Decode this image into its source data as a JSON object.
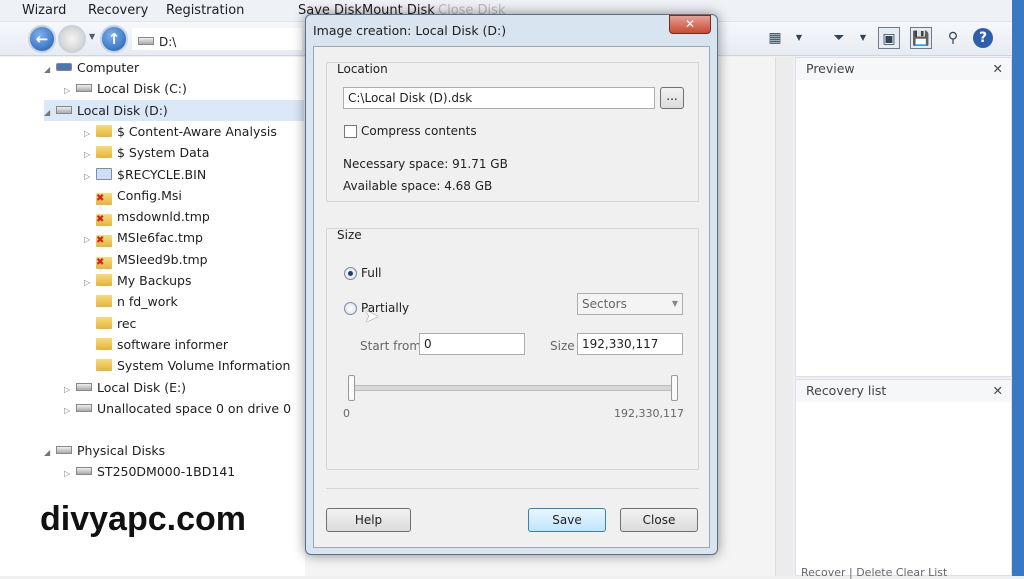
{
  "menu": {
    "items": [
      "Wizard",
      "Recovery",
      "Registration"
    ],
    "disk_actions": [
      "Save Disk",
      "Mount Disk",
      "Close Disk"
    ]
  },
  "nav": {
    "address": "D:\\"
  },
  "toolbar": {
    "icons": [
      "view-mode-icon",
      "filter-icon",
      "preview-toggle-icon",
      "save-icon",
      "search-icon",
      "help-icon"
    ]
  },
  "tree": {
    "items": [
      {
        "label": "Computer",
        "level": 0,
        "type": "computer"
      },
      {
        "label": "Local Disk (C:)",
        "level": 1,
        "type": "disk"
      },
      {
        "label": "Local Disk (D:)",
        "level": 1,
        "type": "disk",
        "selected": true
      },
      {
        "label": "$ Content-Aware Analysis",
        "level": 2,
        "type": "folder"
      },
      {
        "label": "$ System Data",
        "level": 2,
        "type": "folder"
      },
      {
        "label": "$RECYCLE.BIN",
        "level": 2,
        "type": "recycle"
      },
      {
        "label": "Config.Msi",
        "level": 2,
        "type": "deleted"
      },
      {
        "label": "msdownld.tmp",
        "level": 2,
        "type": "deleted"
      },
      {
        "label": "MSIe6fac.tmp",
        "level": 2,
        "type": "deleted"
      },
      {
        "label": "MSIeed9b.tmp",
        "level": 2,
        "type": "deleted"
      },
      {
        "label": "My Backups",
        "level": 2,
        "type": "folder"
      },
      {
        "label": "n fd_work",
        "level": 2,
        "type": "folder"
      },
      {
        "label": "rec",
        "level": 2,
        "type": "folder"
      },
      {
        "label": "software informer",
        "level": 2,
        "type": "folder"
      },
      {
        "label": "System Volume Information",
        "level": 2,
        "type": "folder"
      },
      {
        "label": "Local Disk (E:)",
        "level": 1,
        "type": "disk"
      },
      {
        "label": "Unallocated space 0 on drive 0",
        "level": 1,
        "type": "disk"
      },
      {
        "label": "Physical Disks",
        "level": 0,
        "type": "disk"
      },
      {
        "label": "ST250DM000-1BD141",
        "level": 1,
        "type": "disk"
      }
    ]
  },
  "preview": {
    "title": "Preview"
  },
  "recovery_list": {
    "title": "Recovery list",
    "buttons": [
      "Recover",
      "Delete",
      "Clear List"
    ]
  },
  "watermark": "divyapc.com",
  "dialog": {
    "title": "Image creation: Local Disk (D:)",
    "close": "✕",
    "location_label": "Location",
    "path": "C:\\Local Disk (D).dsk",
    "browse": "...",
    "compress_label": "Compress contents",
    "compress_checked": false,
    "necessary": "Necessary space: 91.71 GB",
    "available": "Available space: 4.68 GB",
    "size_label": "Size",
    "full_label": "Full",
    "partially_label": "Partially",
    "selected_mode": "Full",
    "unit": "Sectors",
    "start_label": "Start from",
    "start_value": "0",
    "size_field_label": "Size",
    "size_value": "192,330,117",
    "range_min": "0",
    "range_max": "192,330,117",
    "help": "Help",
    "save": "Save",
    "close_btn": "Close"
  }
}
